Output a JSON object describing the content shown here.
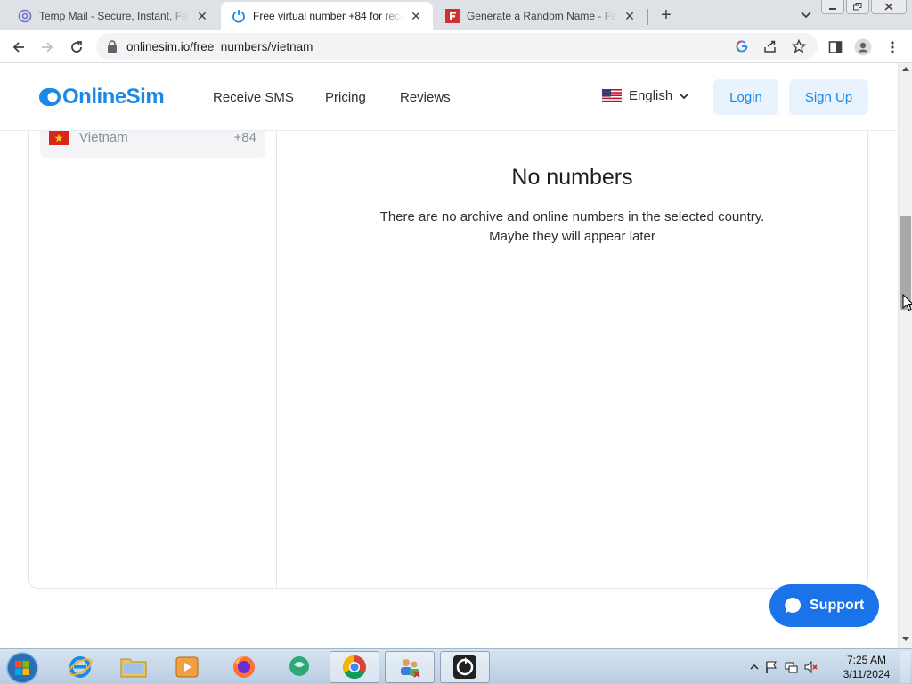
{
  "browser": {
    "tabs": [
      {
        "title": "Temp Mail - Secure, Instant, Fast",
        "icon": "at-sign-icon",
        "active": false
      },
      {
        "title": "Free virtual number +84 for rece",
        "icon": "power-icon",
        "active": true
      },
      {
        "title": "Generate a Random Name - Fake",
        "icon": "letter-f-icon",
        "active": false
      }
    ],
    "new_tab_glyph": "+",
    "url": "onlinesim.io/free_numbers/vietnam"
  },
  "site": {
    "logo_text": "OnlineSim",
    "nav": [
      "Receive SMS",
      "Pricing",
      "Reviews"
    ],
    "language": "English",
    "login_label": "Login",
    "signup_label": "Sign Up"
  },
  "sidebar": {
    "country": {
      "name": "Vietnam",
      "code": "+84"
    }
  },
  "main": {
    "empty_title": "No numbers",
    "empty_line1": "There are no archive and online numbers in the selected country.",
    "empty_line2": "Maybe they will appear later"
  },
  "support_label": "Support",
  "taskbar": {
    "time": "7:25 AM",
    "date": "3/11/2024"
  },
  "colors": {
    "brand_blue": "#1e88e5",
    "support_blue": "#1a73e8",
    "soft_button_bg": "#e8f3fd"
  }
}
